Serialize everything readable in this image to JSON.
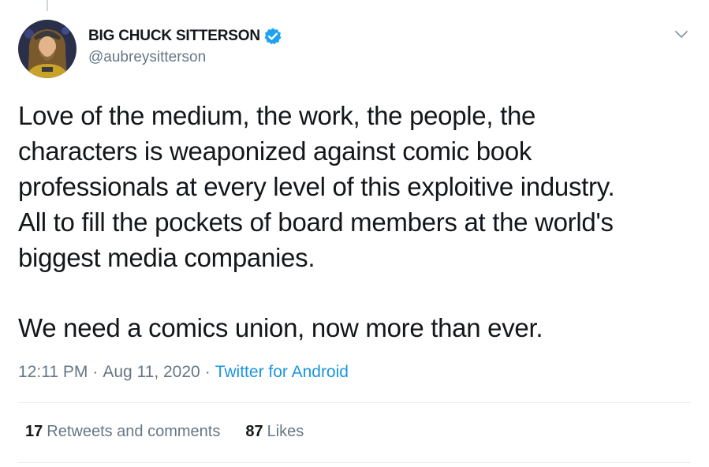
{
  "author": {
    "display_name": "BIG CHUCK SITTERSON",
    "handle": "@aubreysitterson",
    "verified": true,
    "avatar_icon": "user-avatar"
  },
  "tweet": {
    "paragraph1": "Love of the medium, the work, the people, the\ncharacters is weaponized against comic book\nprofessionals at every level of this exploitive industry.\nAll to fill the pockets of board members at the world's\nbiggest media companies.",
    "paragraph2": "We need a comics union, now more than ever."
  },
  "meta": {
    "time": "12:11 PM",
    "separator1": "·",
    "date": "Aug 11, 2020",
    "separator2": "·",
    "source": "Twitter for Android"
  },
  "stats": {
    "retweets_count": "17",
    "retweets_label": "Retweets and comments",
    "likes_count": "87",
    "likes_label": "Likes"
  },
  "colors": {
    "text": "#14171a",
    "secondary": "#657786",
    "link": "#1b95e0",
    "verified": "#1da1f2",
    "divider": "#e6ecf0"
  },
  "icons": {
    "verified": "verified-badge-icon",
    "caret": "chevron-down-icon"
  }
}
